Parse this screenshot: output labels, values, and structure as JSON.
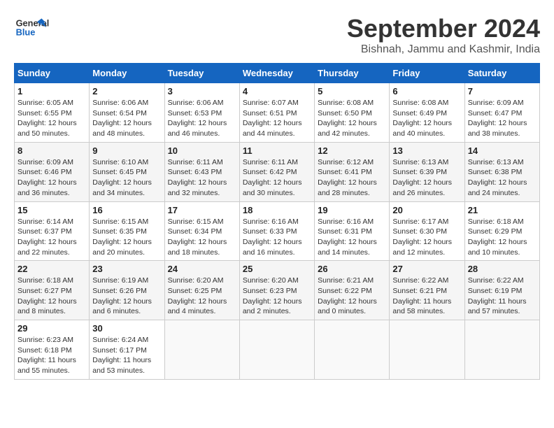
{
  "header": {
    "logo_line1": "General",
    "logo_line2": "Blue",
    "month": "September 2024",
    "location": "Bishnah, Jammu and Kashmir, India"
  },
  "weekdays": [
    "Sunday",
    "Monday",
    "Tuesday",
    "Wednesday",
    "Thursday",
    "Friday",
    "Saturday"
  ],
  "weeks": [
    [
      {
        "day": "1",
        "sunrise": "6:05 AM",
        "sunset": "6:55 PM",
        "daylight": "12 hours and 50 minutes."
      },
      {
        "day": "2",
        "sunrise": "6:06 AM",
        "sunset": "6:54 PM",
        "daylight": "12 hours and 48 minutes."
      },
      {
        "day": "3",
        "sunrise": "6:06 AM",
        "sunset": "6:53 PM",
        "daylight": "12 hours and 46 minutes."
      },
      {
        "day": "4",
        "sunrise": "6:07 AM",
        "sunset": "6:51 PM",
        "daylight": "12 hours and 44 minutes."
      },
      {
        "day": "5",
        "sunrise": "6:08 AM",
        "sunset": "6:50 PM",
        "daylight": "12 hours and 42 minutes."
      },
      {
        "day": "6",
        "sunrise": "6:08 AM",
        "sunset": "6:49 PM",
        "daylight": "12 hours and 40 minutes."
      },
      {
        "day": "7",
        "sunrise": "6:09 AM",
        "sunset": "6:47 PM",
        "daylight": "12 hours and 38 minutes."
      }
    ],
    [
      {
        "day": "8",
        "sunrise": "6:09 AM",
        "sunset": "6:46 PM",
        "daylight": "12 hours and 36 minutes."
      },
      {
        "day": "9",
        "sunrise": "6:10 AM",
        "sunset": "6:45 PM",
        "daylight": "12 hours and 34 minutes."
      },
      {
        "day": "10",
        "sunrise": "6:11 AM",
        "sunset": "6:43 PM",
        "daylight": "12 hours and 32 minutes."
      },
      {
        "day": "11",
        "sunrise": "6:11 AM",
        "sunset": "6:42 PM",
        "daylight": "12 hours and 30 minutes."
      },
      {
        "day": "12",
        "sunrise": "6:12 AM",
        "sunset": "6:41 PM",
        "daylight": "12 hours and 28 minutes."
      },
      {
        "day": "13",
        "sunrise": "6:13 AM",
        "sunset": "6:39 PM",
        "daylight": "12 hours and 26 minutes."
      },
      {
        "day": "14",
        "sunrise": "6:13 AM",
        "sunset": "6:38 PM",
        "daylight": "12 hours and 24 minutes."
      }
    ],
    [
      {
        "day": "15",
        "sunrise": "6:14 AM",
        "sunset": "6:37 PM",
        "daylight": "12 hours and 22 minutes."
      },
      {
        "day": "16",
        "sunrise": "6:15 AM",
        "sunset": "6:35 PM",
        "daylight": "12 hours and 20 minutes."
      },
      {
        "day": "17",
        "sunrise": "6:15 AM",
        "sunset": "6:34 PM",
        "daylight": "12 hours and 18 minutes."
      },
      {
        "day": "18",
        "sunrise": "6:16 AM",
        "sunset": "6:33 PM",
        "daylight": "12 hours and 16 minutes."
      },
      {
        "day": "19",
        "sunrise": "6:16 AM",
        "sunset": "6:31 PM",
        "daylight": "12 hours and 14 minutes."
      },
      {
        "day": "20",
        "sunrise": "6:17 AM",
        "sunset": "6:30 PM",
        "daylight": "12 hours and 12 minutes."
      },
      {
        "day": "21",
        "sunrise": "6:18 AM",
        "sunset": "6:29 PM",
        "daylight": "12 hours and 10 minutes."
      }
    ],
    [
      {
        "day": "22",
        "sunrise": "6:18 AM",
        "sunset": "6:27 PM",
        "daylight": "12 hours and 8 minutes."
      },
      {
        "day": "23",
        "sunrise": "6:19 AM",
        "sunset": "6:26 PM",
        "daylight": "12 hours and 6 minutes."
      },
      {
        "day": "24",
        "sunrise": "6:20 AM",
        "sunset": "6:25 PM",
        "daylight": "12 hours and 4 minutes."
      },
      {
        "day": "25",
        "sunrise": "6:20 AM",
        "sunset": "6:23 PM",
        "daylight": "12 hours and 2 minutes."
      },
      {
        "day": "26",
        "sunrise": "6:21 AM",
        "sunset": "6:22 PM",
        "daylight": "12 hours and 0 minutes."
      },
      {
        "day": "27",
        "sunrise": "6:22 AM",
        "sunset": "6:21 PM",
        "daylight": "11 hours and 58 minutes."
      },
      {
        "day": "28",
        "sunrise": "6:22 AM",
        "sunset": "6:19 PM",
        "daylight": "11 hours and 57 minutes."
      }
    ],
    [
      {
        "day": "29",
        "sunrise": "6:23 AM",
        "sunset": "6:18 PM",
        "daylight": "11 hours and 55 minutes."
      },
      {
        "day": "30",
        "sunrise": "6:24 AM",
        "sunset": "6:17 PM",
        "daylight": "11 hours and 53 minutes."
      },
      null,
      null,
      null,
      null,
      null
    ]
  ]
}
